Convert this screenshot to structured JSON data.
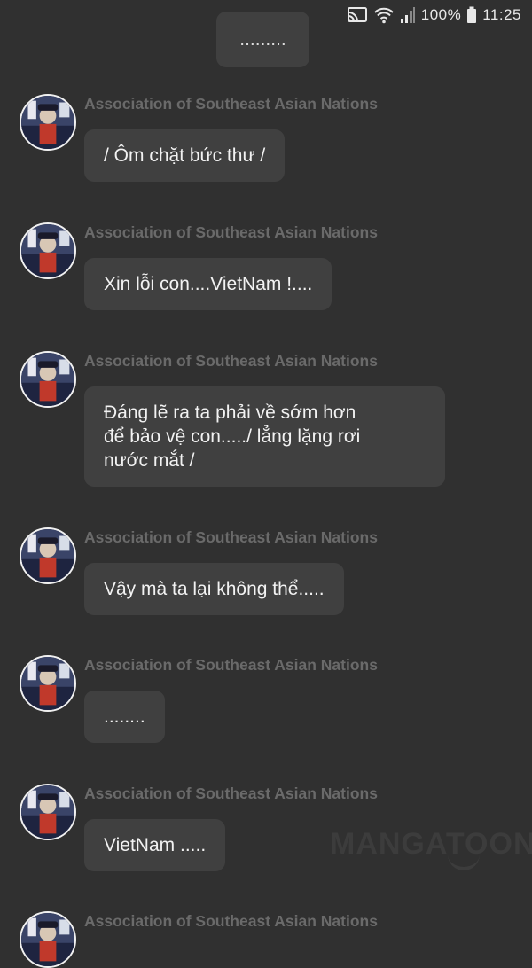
{
  "status_bar": {
    "battery": "100%",
    "time": "11:25",
    "icons": [
      "cast-icon",
      "wifi-icon",
      "signal-icon",
      "battery-icon"
    ]
  },
  "top_bubble": {
    "text": "........."
  },
  "messages": [
    {
      "sender": "Association of Southeast Asian Nations",
      "text": "/ Ôm chặt bức thư /"
    },
    {
      "sender": "Association of Southeast Asian Nations",
      "text": "Xin lỗi con....VietNam !...."
    },
    {
      "sender": "Association of Southeast Asian Nations",
      "text": "Đáng lẽ ra ta phải về sớm hơn\nđể bảo vệ con...../ lẳng lặng rơi\nnước mắt /"
    },
    {
      "sender": "Association of Southeast Asian Nations",
      "text": "Vậy mà ta lại không thể....."
    },
    {
      "sender": "Association of Southeast Asian Nations",
      "text": "........"
    },
    {
      "sender": "Association of Southeast Asian Nations",
      "text": "VietNam ....."
    },
    {
      "sender": "Association of Southeast Asian Nations",
      "text": ""
    }
  ],
  "watermark": "MANGATOON",
  "colors": {
    "background": "#303030",
    "bubble": "#404040",
    "sender": "#6a6a6a",
    "text": "#f2f2f2"
  }
}
